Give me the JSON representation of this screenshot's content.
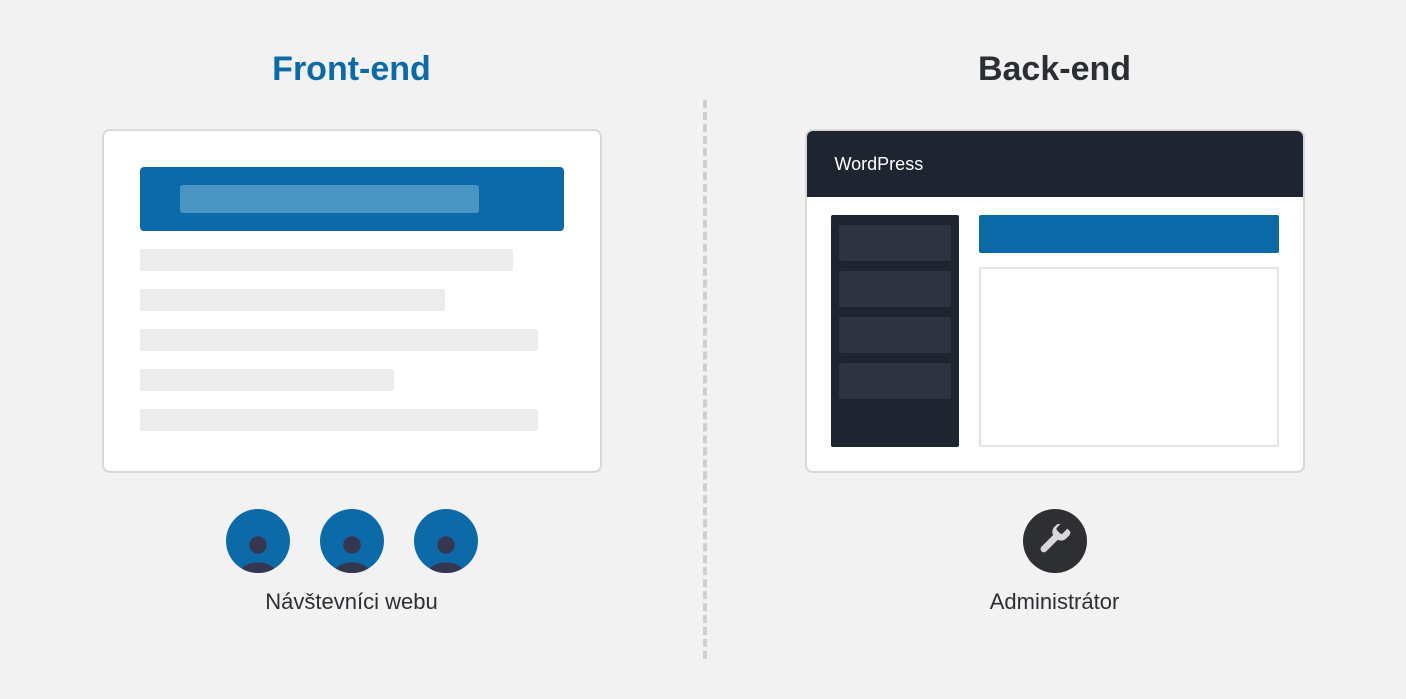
{
  "frontend": {
    "title": "Front-end",
    "caption": "Návštevníci webu"
  },
  "backend": {
    "title": "Back-end",
    "topbar_label": "WordPress",
    "caption": "Administrátor"
  }
}
